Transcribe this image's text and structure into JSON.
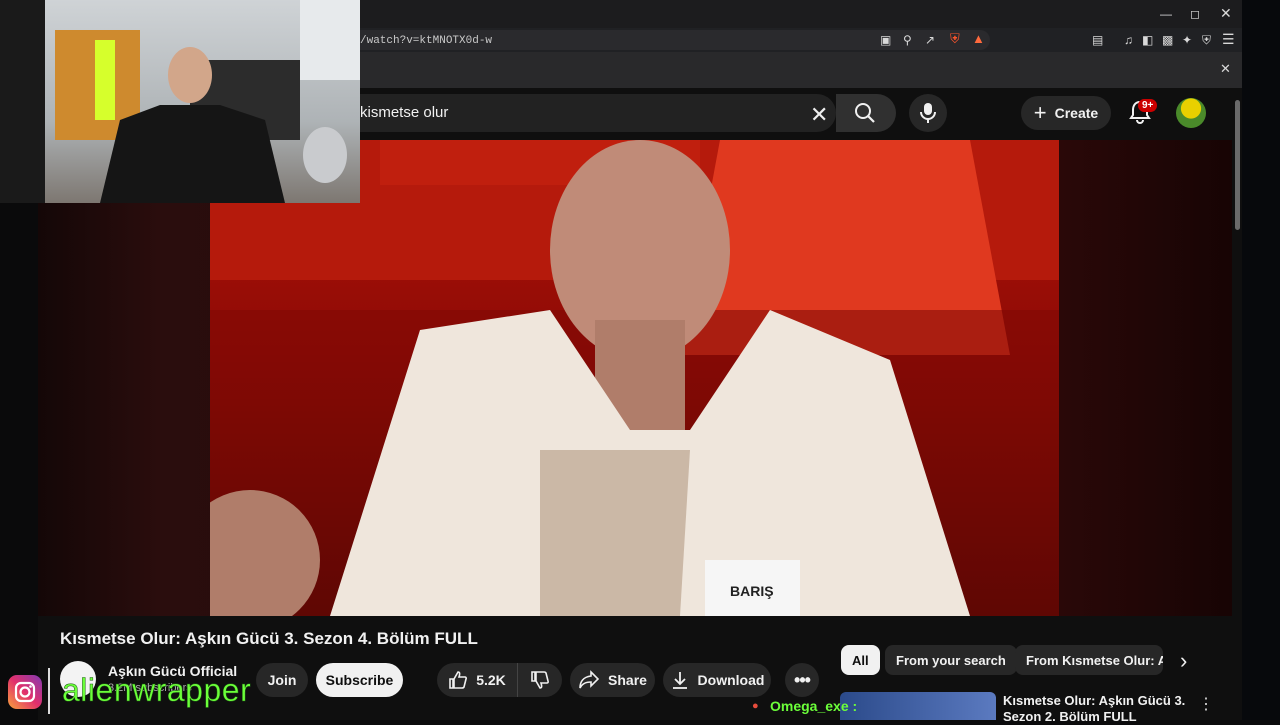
{
  "browser": {
    "url": "/watch?v=ktMNOTX0d-w",
    "window_controls": [
      "minimize",
      "maximize",
      "close"
    ]
  },
  "youtube_header": {
    "search_query": "kismetse olur",
    "create_label": "Create",
    "notification_badge": "9+"
  },
  "video": {
    "name_tag": "BARIŞ",
    "title": "Kısmetse Olur: Aşkın Gücü 3. Sezon 4. Bölüm FULL"
  },
  "channel": {
    "name": "Aşkın Gücü Official",
    "subscribers": "3.2M subscribers",
    "join_label": "Join",
    "subscribe_label": "Subscribe"
  },
  "actions": {
    "like_count": "5.2K",
    "share_label": "Share",
    "download_label": "Download"
  },
  "filter_chips": [
    "All",
    "From your search",
    "From Kısmetse Olur: Aş"
  ],
  "recommended": {
    "title": "Kısmetse Olur: Aşkın Gücü 3. Sezon 2. Bölüm FULL"
  },
  "stream_overlay": {
    "watermark": "alienwrapper",
    "chat_user": "Omega_exe :"
  },
  "colors": {
    "youtube_bg": "#0f0f0f",
    "accent_red": "#cc0000",
    "overlay_green": "#6cff3a"
  }
}
